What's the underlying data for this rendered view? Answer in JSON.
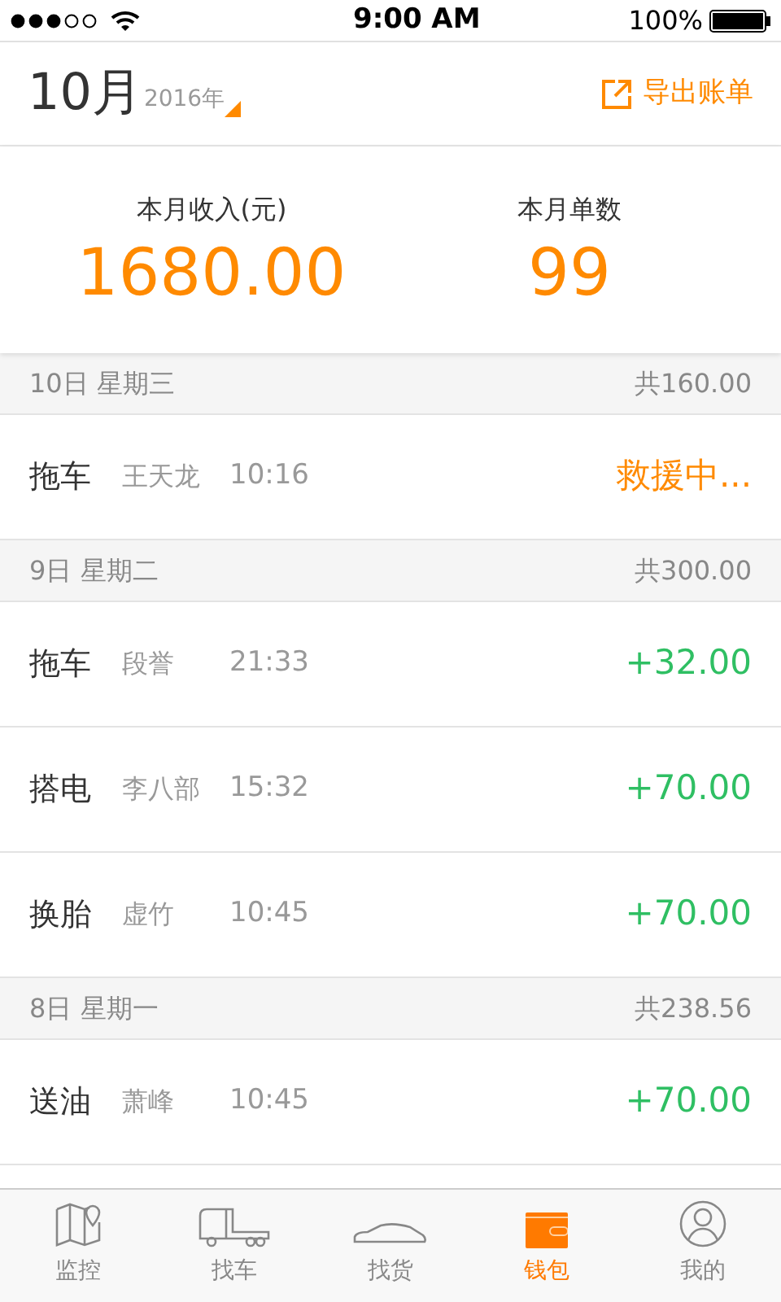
{
  "status_bar": {
    "time": "9:00 AM",
    "battery": "100%"
  },
  "header": {
    "month": "10月",
    "year": "2016年",
    "export": "导出账单"
  },
  "summary": [
    {
      "label": "本月收入(元)",
      "value": "1680.00"
    },
    {
      "label": "本月单数",
      "value": "99"
    }
  ],
  "days": [
    {
      "date": "10日 星期三",
      "total": "共160.00",
      "orders": [
        {
          "service": "拖车",
          "driver": "王天龙",
          "time": "10:16",
          "result": "救援中...",
          "kind": "pending"
        }
      ]
    },
    {
      "date": "9日 星期二",
      "total": "共300.00",
      "orders": [
        {
          "service": "拖车",
          "driver": "段誉",
          "time": "21:33",
          "result": "+32.00",
          "kind": "amount"
        },
        {
          "service": "搭电",
          "driver": "李八部",
          "time": "15:32",
          "result": "+70.00",
          "kind": "amount"
        },
        {
          "service": "换胎",
          "driver": "虚竹",
          "time": "10:45",
          "result": "+70.00",
          "kind": "amount"
        }
      ]
    },
    {
      "date": "8日 星期一",
      "total": "共238.56",
      "orders": [
        {
          "service": "送油",
          "driver": "萧峰",
          "time": "10:45",
          "result": "+70.00",
          "kind": "amount"
        }
      ]
    }
  ],
  "tabs": [
    {
      "label": "监控",
      "selected": false
    },
    {
      "label": "找车",
      "selected": false
    },
    {
      "label": "找货",
      "selected": false
    },
    {
      "label": "钱包",
      "selected": true
    },
    {
      "label": "我的",
      "selected": false
    }
  ]
}
